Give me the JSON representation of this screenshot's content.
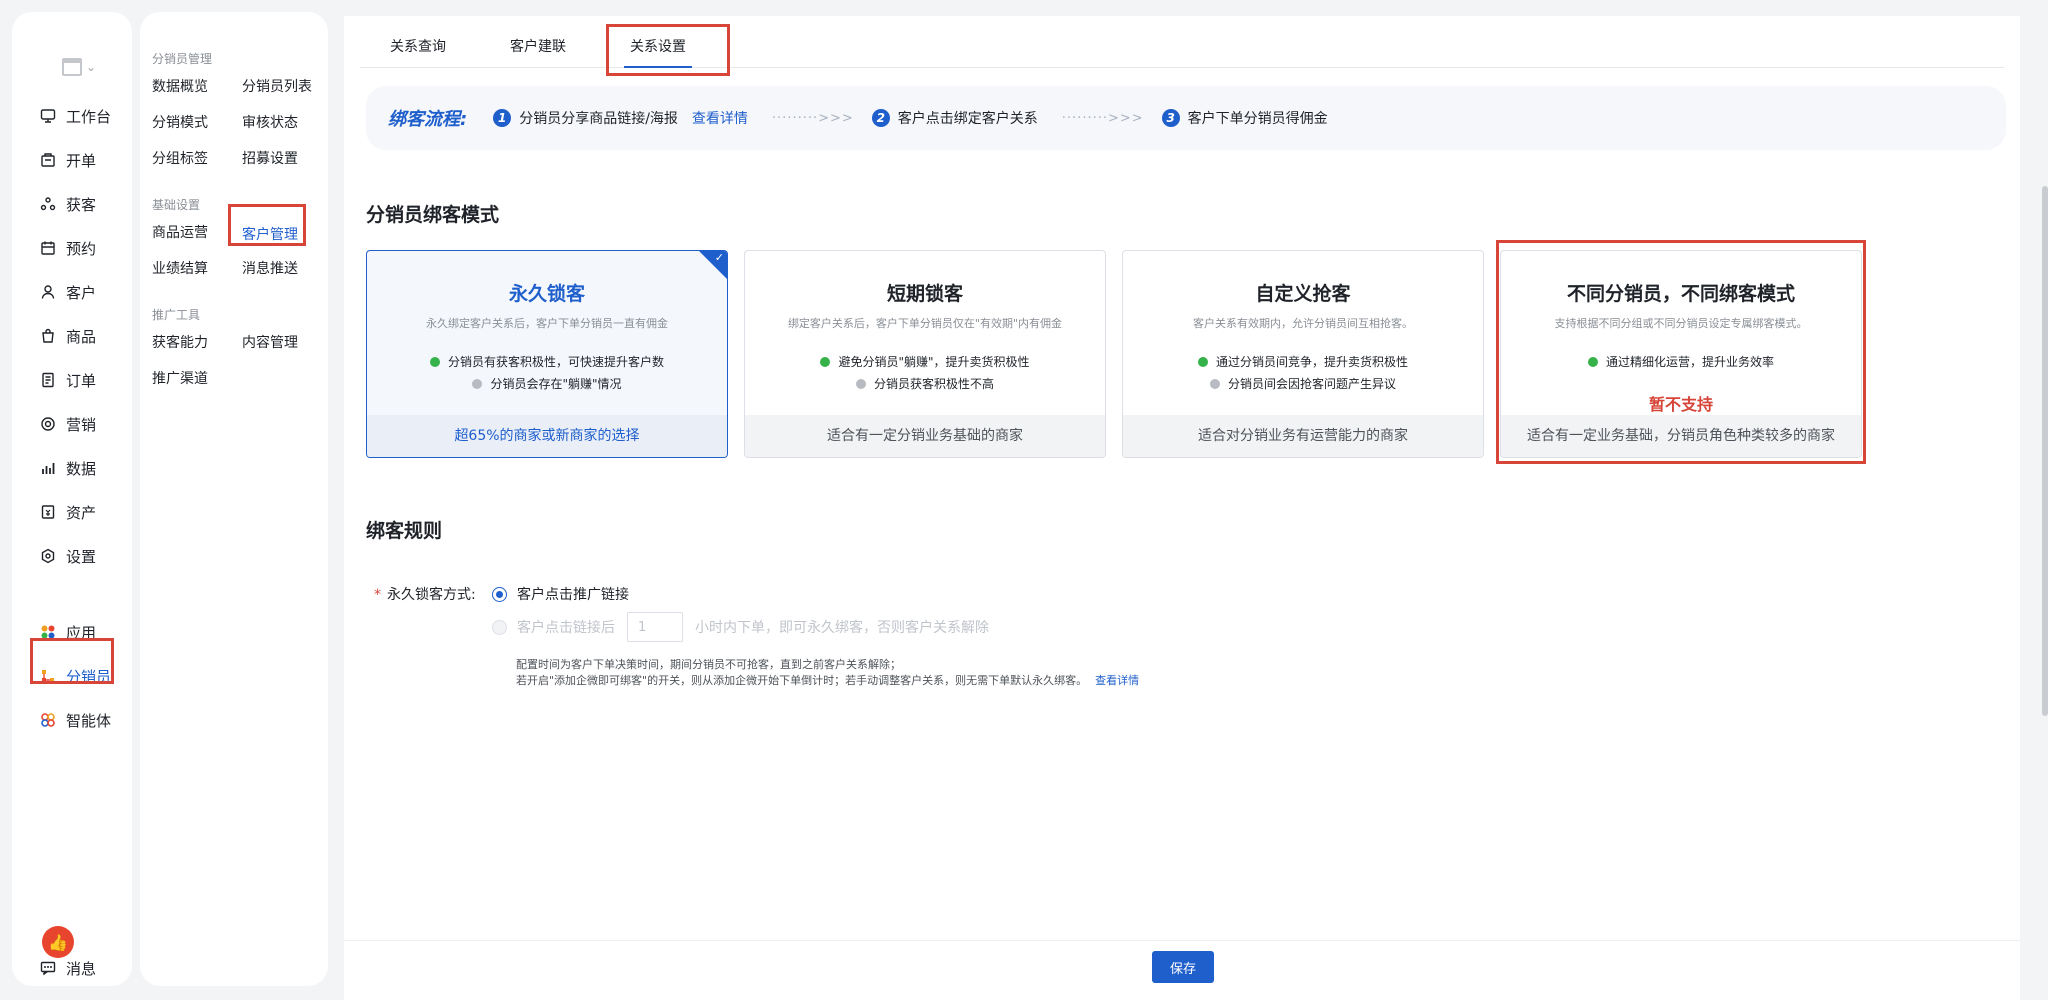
{
  "nav": {
    "items": [
      {
        "label": "工作台",
        "icon": "monitor-icon"
      },
      {
        "label": "开单",
        "icon": "cashier-icon"
      },
      {
        "label": "获客",
        "icon": "users-icon"
      },
      {
        "label": "预约",
        "icon": "calendar-icon"
      },
      {
        "label": "客户",
        "icon": "person-icon"
      },
      {
        "label": "商品",
        "icon": "bag-icon"
      },
      {
        "label": "订单",
        "icon": "order-icon"
      },
      {
        "label": "营销",
        "icon": "target-icon"
      },
      {
        "label": "数据",
        "icon": "bar-chart-icon"
      },
      {
        "label": "资产",
        "icon": "asset-icon"
      },
      {
        "label": "设置",
        "icon": "gear-icon"
      }
    ],
    "apps": [
      {
        "label": "应用",
        "icon": "apps-icon"
      },
      {
        "label": "分销员",
        "icon": "distributor-icon"
      },
      {
        "label": "智能体",
        "icon": "agent-icon"
      }
    ],
    "message_label": "消息"
  },
  "submenu": {
    "groups": [
      {
        "title": "分销员管理",
        "links": [
          "数据概览",
          "分销员列表",
          "分销模式",
          "审核状态",
          "分组标签",
          "招募设置"
        ]
      },
      {
        "title": "基础设置",
        "links": [
          "商品运营",
          "客户管理",
          "业绩结算",
          "消息推送"
        ]
      },
      {
        "title": "推广工具",
        "links": [
          "获客能力",
          "内容管理",
          "推广渠道"
        ]
      }
    ]
  },
  "tabs": [
    "关系查询",
    "客户建联",
    "关系设置"
  ],
  "flow": {
    "title": "绑客流程:",
    "steps": [
      {
        "num": "1",
        "text": "分销员分享商品链接/海报",
        "link": "查看详情"
      },
      {
        "num": "2",
        "text": "客户点击绑定客户关系"
      },
      {
        "num": "3",
        "text": "客户下单分销员得佣金"
      }
    ],
    "arrow": "·········>>>"
  },
  "section_mode_title": "分销员绑客模式",
  "cards": [
    {
      "title": "永久锁客",
      "desc": "永久绑定客户关系后，客户下单分销员一直有佣金",
      "pro": "分销员有获客积极性，可快速提升客户数",
      "con": "分销员会存在\"躺赚\"情况",
      "foot": "超65%的商家或新商家的选择"
    },
    {
      "title": "短期锁客",
      "desc": "绑定客户关系后，客户下单分销员仅在\"有效期\"内有佣金",
      "pro": "避免分销员\"躺赚\"，提升卖货积极性",
      "con": "分销员获客积极性不高",
      "foot": "适合有一定分销业务基础的商家"
    },
    {
      "title": "自定义抢客",
      "desc": "客户关系有效期内，允许分销员间互相抢客。",
      "pro": "通过分销员间竞争，提升卖货积极性",
      "con": "分销员间会因抢客问题产生异议",
      "foot": "适合对分销业务有运营能力的商家"
    },
    {
      "title": "不同分销员，不同绑客模式",
      "desc": "支持根据不同分组或不同分销员设定专属绑客模式。",
      "pro": "通过精细化运营，提升业务效率",
      "unsupported": "暂不支持",
      "foot": "适合有一定业务基础，分销员角色种类较多的商家"
    }
  ],
  "section_rule_title": "绑客规则",
  "rule": {
    "label": "永久锁客方式:",
    "option1": "客户点击推广链接",
    "option2_prefix": "客户点击链接后",
    "option2_value": "1",
    "option2_suffix": "小时内下单，即可永久绑客，否则客户关系解除",
    "note_line1": "配置时间为客户下单决策时间，期间分销员不可抢客，直到之前客户关系解除；",
    "note_line2": "若开启\"添加企微即可绑客\"的开关，则从添加企微开始下单倒计时；若手动调整客户关系，则无需下单默认永久绑客。",
    "note_link": "查看详情"
  },
  "footer": {
    "save_label": "保存"
  },
  "colors": {
    "accent": "#1f5fcc",
    "highlight": "#d64538",
    "success": "#35b24a"
  }
}
